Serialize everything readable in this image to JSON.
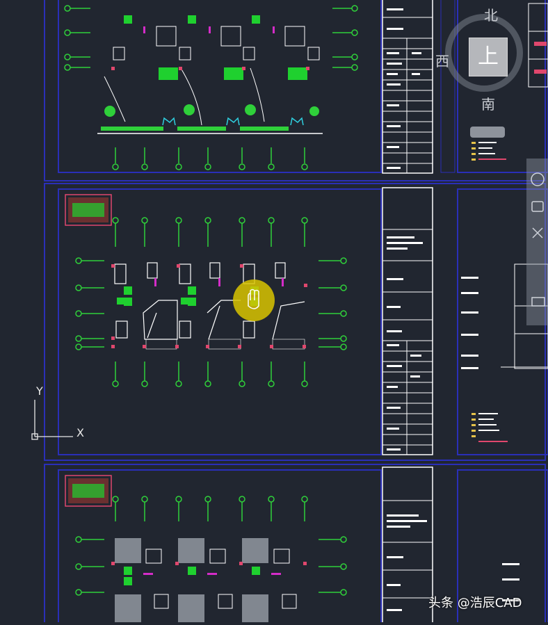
{
  "app": "CAD drawing workspace",
  "viewcube": {
    "north": "北",
    "south": "南",
    "west": "西",
    "face": "上"
  },
  "ucs": {
    "x_label": "X",
    "y_label": "Y"
  },
  "watermark": "头条 @浩辰CAD",
  "colors": {
    "background": "#212630",
    "frame": "#2a2fb8",
    "wall": "#ffffff",
    "furniture": "#1fd02f",
    "column": "#e0476d",
    "accent": "#d42cc8",
    "cursor": "#d8c400",
    "tree": "#2fd03a",
    "water": "#2fd0e0"
  },
  "icons": [
    "hand-pan-cursor-icon",
    "ucs-icon",
    "viewcube-icon"
  ]
}
